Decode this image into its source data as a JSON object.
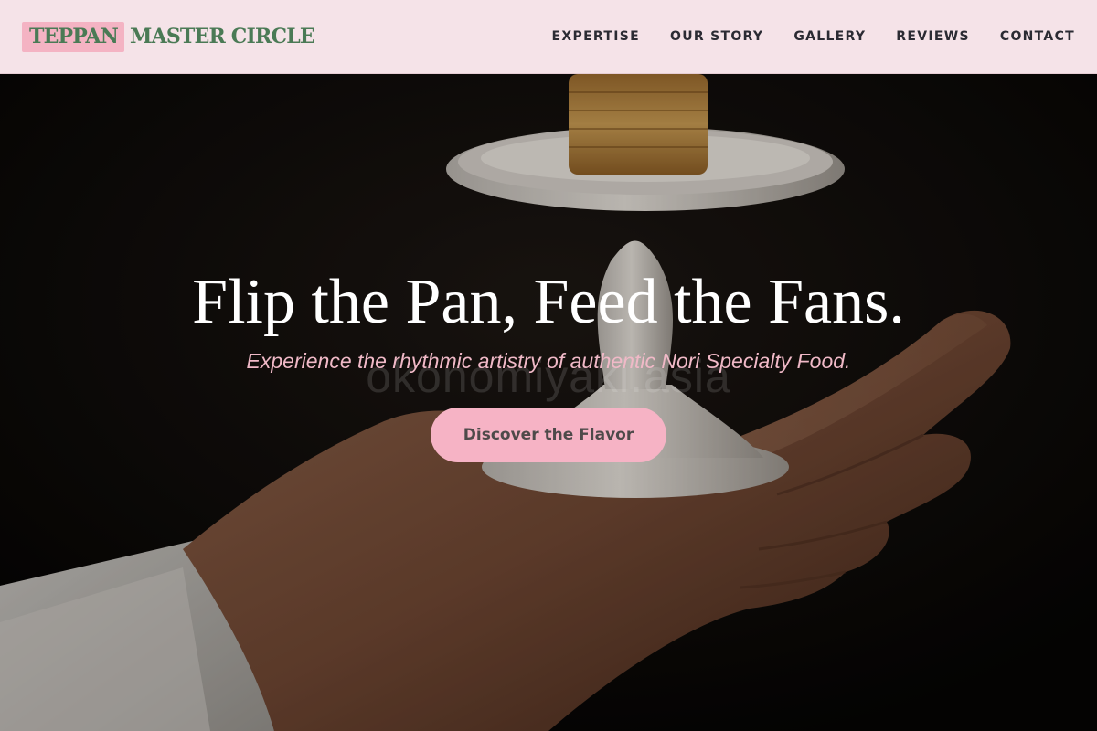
{
  "header": {
    "logo_highlight": "TEPPAN",
    "logo_rest": "MASTER CIRCLE",
    "nav": [
      "EXPERTISE",
      "OUR STORY",
      "GALLERY",
      "REVIEWS",
      "CONTACT"
    ]
  },
  "hero": {
    "title": "Flip the Pan, Feed the Fans.",
    "subtitle": "Experience the rhythmic artistry of authentic Nori Specialty Food.",
    "watermark": "okonomiyaki.asia",
    "cta_label": "Discover the Flavor"
  },
  "colors": {
    "header_bg": "#f5e3e8",
    "logo_green": "#4a7a55",
    "logo_highlight_bg": "#f4b3c3",
    "accent_pink": "#f6b3c5",
    "subtitle_pink": "#f0b9c7"
  }
}
